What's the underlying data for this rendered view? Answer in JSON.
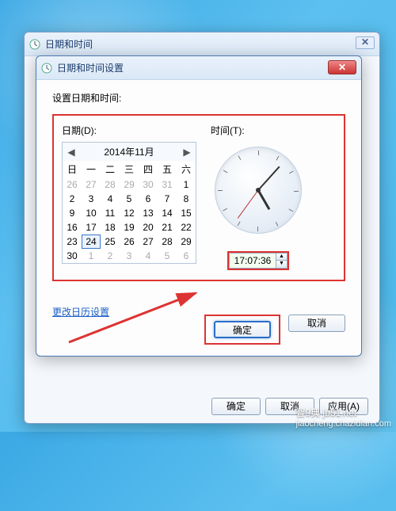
{
  "outer_window": {
    "title": "日期和时间",
    "buttons": {
      "ok": "确定",
      "cancel": "取消",
      "apply": "应用(A)"
    }
  },
  "inner_window": {
    "title": "日期和时间设置",
    "subtitle": "设置日期和时间:",
    "date_label": "日期(D):",
    "time_label": "时间(T):",
    "calendar": {
      "title": "2014年11月",
      "dow": [
        "日",
        "一",
        "二",
        "三",
        "四",
        "五",
        "六"
      ],
      "weeks": [
        [
          {
            "d": "26",
            "o": true
          },
          {
            "d": "27",
            "o": true
          },
          {
            "d": "28",
            "o": true
          },
          {
            "d": "29",
            "o": true
          },
          {
            "d": "30",
            "o": true
          },
          {
            "d": "31",
            "o": true
          },
          {
            "d": "1"
          }
        ],
        [
          {
            "d": "2"
          },
          {
            "d": "3"
          },
          {
            "d": "4"
          },
          {
            "d": "5"
          },
          {
            "d": "6"
          },
          {
            "d": "7"
          },
          {
            "d": "8"
          }
        ],
        [
          {
            "d": "9"
          },
          {
            "d": "10"
          },
          {
            "d": "11"
          },
          {
            "d": "12"
          },
          {
            "d": "13"
          },
          {
            "d": "14"
          },
          {
            "d": "15"
          }
        ],
        [
          {
            "d": "16"
          },
          {
            "d": "17"
          },
          {
            "d": "18"
          },
          {
            "d": "19"
          },
          {
            "d": "20"
          },
          {
            "d": "21"
          },
          {
            "d": "22"
          }
        ],
        [
          {
            "d": "23"
          },
          {
            "d": "24",
            "sel": true
          },
          {
            "d": "25"
          },
          {
            "d": "26"
          },
          {
            "d": "27"
          },
          {
            "d": "28"
          },
          {
            "d": "29"
          }
        ],
        [
          {
            "d": "30"
          },
          {
            "d": "1",
            "o": true
          },
          {
            "d": "2",
            "o": true
          },
          {
            "d": "3",
            "o": true
          },
          {
            "d": "4",
            "o": true
          },
          {
            "d": "5",
            "o": true
          },
          {
            "d": "6",
            "o": true
          }
        ]
      ]
    },
    "time_value": "17:07:36",
    "link": "更改日历设置",
    "ok": "确定",
    "cancel": "取消"
  },
  "watermark": {
    "line1": "智9典 jb51.net",
    "line2": "jiaocheng.chazidian.com"
  }
}
